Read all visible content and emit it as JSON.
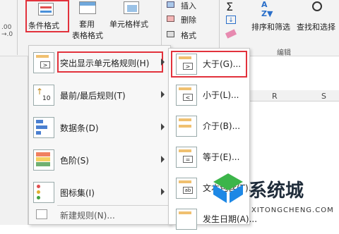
{
  "ribbon": {
    "num_format_hint": ".00\n.00",
    "conditional_format_label": "条件格式",
    "format_as_table_label_1": "套用",
    "format_as_table_label_2": "表格格式",
    "cell_styles_label": "单元格样式",
    "insert_label": "插入",
    "delete_label": "删除",
    "format_label": "格式",
    "sort_filter_label": "排序和筛选",
    "find_select_label": "查找和选择",
    "edit_group_label": "编辑"
  },
  "main_menu": {
    "items": [
      {
        "label": "突出显示单元格规则(H)"
      },
      {
        "label": "最前/最后规则(T)"
      },
      {
        "label": "数据条(D)"
      },
      {
        "label": "色阶(S)"
      },
      {
        "label": "图标集(I)"
      },
      {
        "label": "新建规则(N)..."
      }
    ],
    "top10_text": "10"
  },
  "submenu": {
    "items": [
      {
        "label": "大于(G)..."
      },
      {
        "label": "小于(L)..."
      },
      {
        "label": "介于(B)..."
      },
      {
        "label": "等于(E)..."
      },
      {
        "label": "文本包含(T)..."
      },
      {
        "label": "发生日期(A)..."
      }
    ]
  },
  "sheet": {
    "col_r": "R",
    "col_s": "S"
  },
  "watermark": {
    "brand": "系统城",
    "url": "XITONGCHENG.COM"
  },
  "colors": {
    "highlight_red": "#e2323c",
    "logo_blue": "#1e88e5",
    "logo_green": "#3cb54a"
  }
}
